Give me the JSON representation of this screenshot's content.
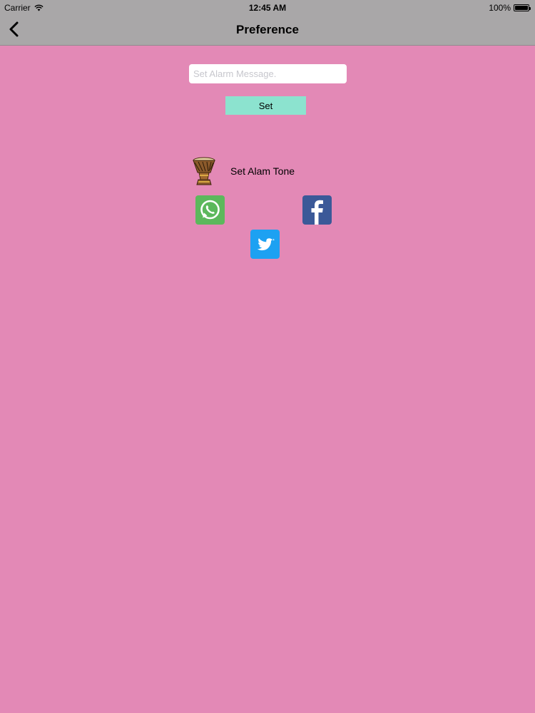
{
  "status_bar": {
    "carrier": "Carrier",
    "time": "12:45 AM",
    "battery": "100%"
  },
  "nav": {
    "title": "Preference",
    "back_icon": "chevron-left-icon"
  },
  "form": {
    "message_placeholder": "Set Alarm Message.",
    "message_value": "",
    "set_label": "Set"
  },
  "tone": {
    "label": "Set Alam Tone",
    "icon": "drum-icon"
  },
  "social": {
    "whatsapp_icon": "whatsapp-icon",
    "facebook_icon": "facebook-icon",
    "twitter_icon": "twitter-icon"
  },
  "colors": {
    "background": "#e389b6",
    "header": "#a9a7a8",
    "set_button": "#8ce3cf",
    "whatsapp": "#5cb85c",
    "facebook": "#3b5998",
    "twitter": "#1da1f2"
  }
}
